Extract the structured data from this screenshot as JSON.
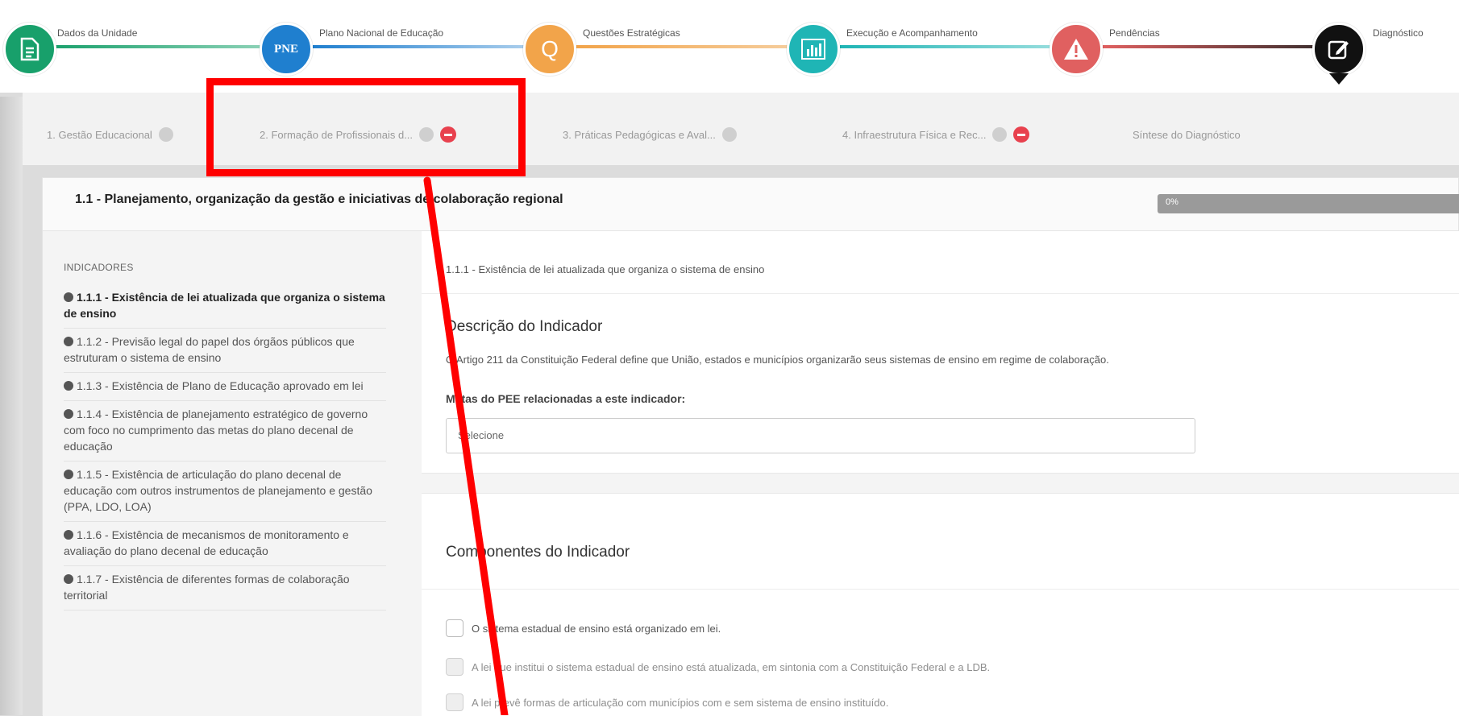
{
  "stepper": {
    "steps": [
      {
        "label": "Dados da Unidade",
        "icon": "document-icon",
        "color": "#18a06b"
      },
      {
        "label": "Plano Nacional de Educação",
        "icon_text": "PNE",
        "color": "#1f7fcf"
      },
      {
        "label": "Questões Estratégicas",
        "icon_text": "Q",
        "color": "#f2a44a"
      },
      {
        "label": "Execução e Acompanhamento",
        "icon": "bar-chart-icon",
        "color": "#1fb5b5"
      },
      {
        "label": "Pendências",
        "icon": "warning-icon",
        "color": "#e06060"
      },
      {
        "label": "Diagnóstico",
        "icon": "edit-icon",
        "color": "#111111"
      }
    ]
  },
  "tabs": [
    {
      "label": "1. Gestão Educacional"
    },
    {
      "label": "2. Formação de Profissionais d..."
    },
    {
      "label": "3. Práticas Pedagógicas e Aval..."
    },
    {
      "label": "4. Infraestrutura Física e Rec..."
    },
    {
      "label": "Síntese do Diagnóstico"
    }
  ],
  "card": {
    "title": "1.1 - Planejamento, organização da gestão e iniciativas de colaboração regional",
    "progress_label": "0%",
    "progress_value": 0
  },
  "sidebar": {
    "header": "INDICADORES",
    "items": [
      "1.1.1 - Existência de lei atualizada que organiza o sistema de ensino",
      "1.1.2 - Previsão legal do papel dos órgãos públicos que estruturam o sistema de ensino",
      "1.1.3 - Existência de Plano de Educação aprovado em lei",
      "1.1.4 - Existência de planejamento estratégico de governo com foco no cumprimento das metas do plano decenal de educação",
      "1.1.5 - Existência de articulação do plano decenal de educação com outros instrumentos de planejamento e gestão (PPA, LDO, LOA)",
      "1.1.6 - Existência de mecanismos de monitoramento e avaliação do plano decenal de educação",
      "1.1.7 - Existência de diferentes formas de colaboração territorial"
    ]
  },
  "content": {
    "subheader": "1.1.1 - Existência de lei atualizada que organiza o sistema de ensino",
    "description_title": "Descrição do Indicador",
    "description_text": "O Artigo 211 da Constituição Federal define que União, estados e municípios organizarão seus sistemas de ensino em regime de colaboração.",
    "metas_label": "Metas do PEE relacionadas a este indicador:",
    "select_placeholder": "Selecione",
    "components_title": "Componentes do Indicador",
    "components": [
      "O sistema estadual de ensino está organizado em lei.",
      "A lei que institui o sistema estadual de ensino está atualizada, em sintonia com a Constituição Federal e a LDB.",
      "A lei prevê formas de articulação com municípios com e sem sistema de ensino instituído."
    ]
  },
  "annotation": {
    "highlight_color": "#ff0000"
  }
}
